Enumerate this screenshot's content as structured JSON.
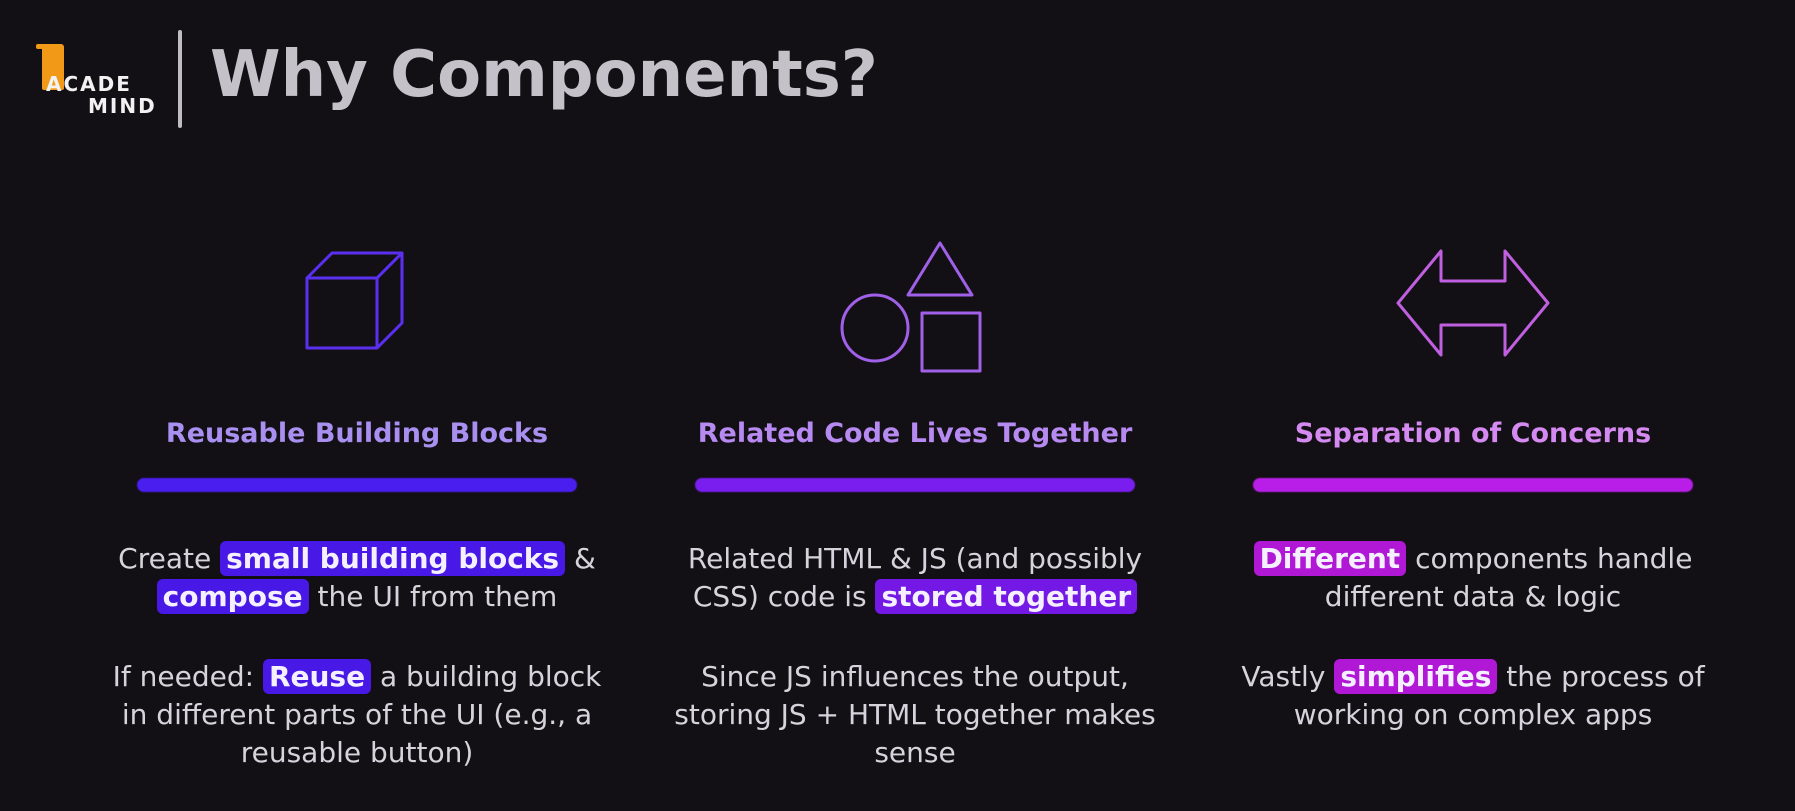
{
  "logo": {
    "line1": "ACADE",
    "line2": "MIND"
  },
  "title": "Why Components?",
  "columns": [
    {
      "icon": "cube-icon",
      "heading": "Reusable Building Blocks",
      "color": "#4b1ef0",
      "heading_color": "#a98ff0",
      "p1": {
        "a": "Create ",
        "h1": "small building blocks",
        "b": " & ",
        "h2": "compose",
        "c": " the UI from them"
      },
      "p2": {
        "a": "If needed: ",
        "h1": "Reuse",
        "b": " a building block in different parts of the UI (e.g., a reusable button)"
      }
    },
    {
      "icon": "shapes-icon",
      "heading": "Related Code Lives Together",
      "color": "#7a1ef0",
      "heading_color": "#b78af2",
      "p1": {
        "a": "Related HTML & JS (and possibly CSS) code is ",
        "h1": "stored together"
      },
      "p2": {
        "a": "Since JS influences the output, storing JS + HTML together makes sense"
      }
    },
    {
      "icon": "double-arrow-icon",
      "heading": "Separation of Concerns",
      "color": "#b81ee8",
      "heading_color": "#d48af0",
      "p1": {
        "h1": "Different",
        "a": " components handle different data & logic"
      },
      "p2": {
        "a": "Vastly ",
        "h1": "simplifies",
        "b": " the process of working on complex apps"
      }
    }
  ]
}
